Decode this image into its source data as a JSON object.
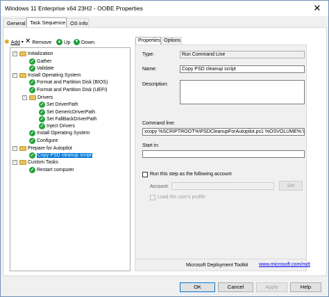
{
  "window": {
    "title": "Windows 11 Enterprise x64 23H2 - OOBE Properties",
    "close_glyph": "✕"
  },
  "tabs": [
    {
      "label": "General"
    },
    {
      "label": "Task Sequence"
    },
    {
      "label": "OS Info"
    }
  ],
  "toolbar": {
    "add_label": "Add",
    "remove_label": "Remove",
    "up_label": "Up",
    "down_label": "Down"
  },
  "tree": {
    "items": [
      {
        "label": "Initialization"
      },
      {
        "label": "Gather"
      },
      {
        "label": "Validate"
      },
      {
        "label": "Install Operating System"
      },
      {
        "label": "Format and Partition Disk (BIOS)"
      },
      {
        "label": "Format and Partition Disk (UEFI)"
      },
      {
        "label": "Drivers"
      },
      {
        "label": "Set DriverPath"
      },
      {
        "label": "Set GenericDriverPath"
      },
      {
        "label": "Set FallBackDriverPath"
      },
      {
        "label": "Inject Drivers"
      },
      {
        "label": "Install Operating System"
      },
      {
        "label": "Configure"
      },
      {
        "label": "Prepare for Autopilot"
      },
      {
        "label": "Copy PSD cleanup script"
      },
      {
        "label": "Custom Tasks"
      },
      {
        "label": "Restart computer"
      }
    ]
  },
  "panel": {
    "tabs": [
      {
        "label": "Properties"
      },
      {
        "label": "Options"
      }
    ],
    "type_label": "Type:",
    "type_value": "Run Command Line",
    "name_label": "Name:",
    "name_value": "Copy PSD cleanup script",
    "description_label": "Description:",
    "description_value": "",
    "command_label": "Command line:",
    "command_value": "xcopy %SCRIPTROOT%\\PSDCleanupForAutopilot.ps1 %OSVOLUME%:\\W",
    "startin_label": "Start in:",
    "startin_value": "",
    "runas_label": "Run this step as the following account",
    "account_label": "Account:",
    "account_value": "",
    "set_label": "Set",
    "loadprofile_label": "Load the user's profile",
    "footer_text": "Microsoft Deployment Toolkit",
    "footer_link": "www.microsoft.com/mdt"
  },
  "buttons": {
    "ok": "OK",
    "cancel": "Cancel",
    "apply": "Apply",
    "help": "Help"
  },
  "colors": {
    "selection": "#0078d7",
    "success_check": "#23a33b",
    "folder": "#e8c25a"
  }
}
